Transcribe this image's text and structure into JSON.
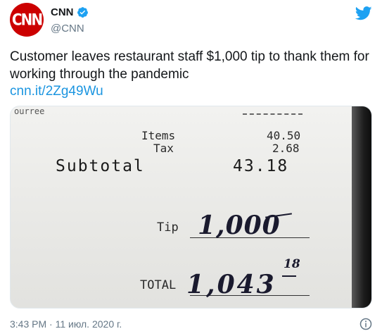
{
  "header": {
    "avatar_text": "CNN",
    "display_name": "CNN",
    "handle": "@CNN",
    "verified": true
  },
  "tweet": {
    "text": "Customer leaves restaurant staff $1,000 tip to thank them for working through the pandemic",
    "link": "cnn.it/2Zg49Wu"
  },
  "media": {
    "receipt": {
      "top_scrap": "ourree",
      "items_label": "Items",
      "items_value": "40.50",
      "tax_label": "Tax",
      "tax_value": "2.68",
      "subtotal_label": "Subtotal",
      "subtotal_value": "43.18",
      "tip_label": "Tip",
      "tip_handwritten": "1,000",
      "total_label": "TOTAL",
      "total_handwritten": "1,043",
      "total_cents_handwritten": "18"
    }
  },
  "footer": {
    "timestamp": "3:43 PM · 11 июл. 2020 г."
  },
  "colors": {
    "brand_red": "#cc0000",
    "verified_blue": "#1da1f2",
    "link_blue": "#1b95e0",
    "twitter_blue": "#1da1f2",
    "secondary_text": "#657786"
  },
  "icons": {
    "verified": "verified-badge-icon",
    "twitter": "twitter-bird-icon",
    "info": "info-icon"
  }
}
